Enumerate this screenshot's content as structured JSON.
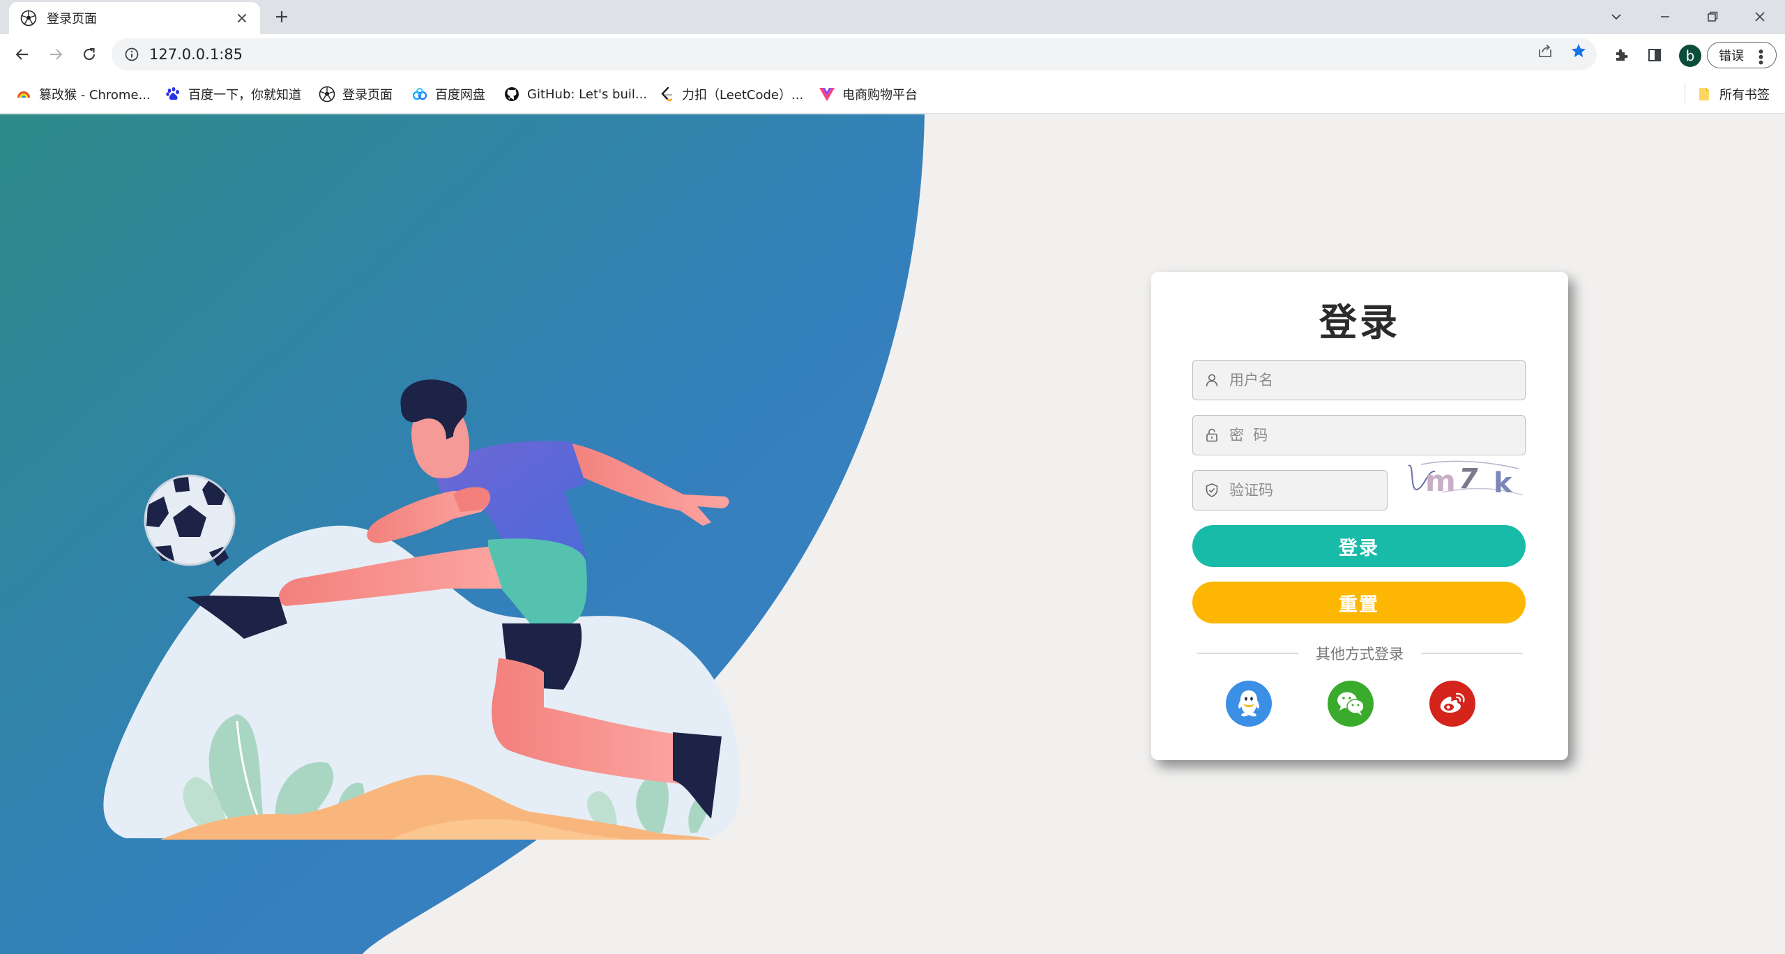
{
  "browser": {
    "tab_title": "登录页面",
    "url": "127.0.0.1:85",
    "profile_initial": "b",
    "error_button_label": "错误",
    "bookmarks": [
      {
        "label": "篡改猴 - Chrome...",
        "icon": "tampermonkey-icon"
      },
      {
        "label": "百度一下，你就知道",
        "icon": "baidu-icon"
      },
      {
        "label": "登录页面",
        "icon": "soccer-ball-icon"
      },
      {
        "label": "百度网盘",
        "icon": "baidu-netdisk-icon"
      },
      {
        "label": "GitHub: Let's buil...",
        "icon": "github-icon"
      },
      {
        "label": "力扣（LeetCode）...",
        "icon": "leetcode-icon"
      },
      {
        "label": "电商购物平台",
        "icon": "vue-icon"
      }
    ],
    "all_bookmarks_label": "所有书签"
  },
  "login": {
    "title": "登录",
    "username_placeholder": "用户名",
    "password_placeholder": "密  码",
    "captcha_placeholder": "验证码",
    "captcha_text": "m7 k",
    "login_button": "登录",
    "reset_button": "重置",
    "other_methods": "其他方式登录",
    "social": [
      "qq-icon",
      "wechat-icon",
      "weibo-icon"
    ]
  },
  "colors": {
    "login_button": "#17bba8",
    "reset_button": "#fdb702",
    "qq": "#3b8fe5",
    "wechat": "#3aab2d",
    "weibo": "#d4241c",
    "bg_gradient_start": "#2f8a8a",
    "bg_gradient_end": "#3a7fc4"
  }
}
